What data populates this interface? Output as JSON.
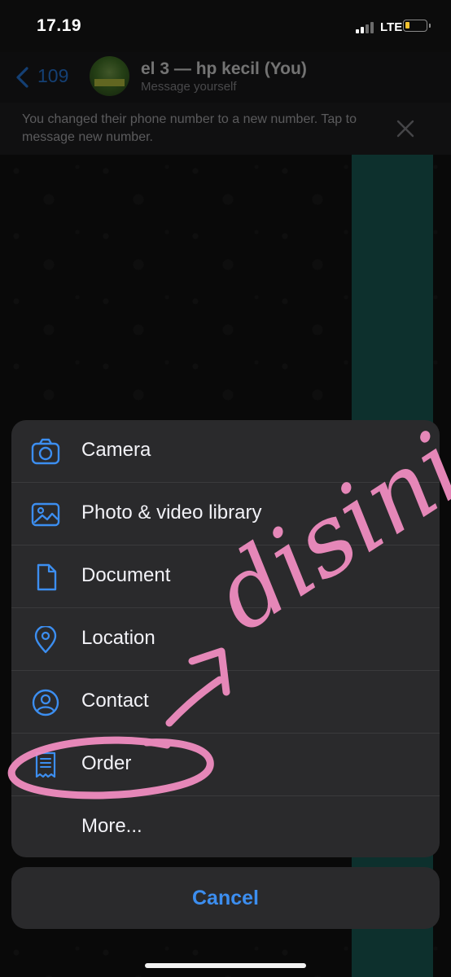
{
  "status_bar": {
    "time": "17.19",
    "network": "LTE",
    "battery_level_percent": 15
  },
  "chat_header": {
    "back_count": "109",
    "title": "el 3 — hp kecil (You)",
    "subtitle": "Message yourself"
  },
  "notice": {
    "text": "You changed their phone number to a new number. Tap to message new number."
  },
  "action_sheet": {
    "items": [
      {
        "label": "Camera",
        "icon": "camera-icon"
      },
      {
        "label": "Photo & video library",
        "icon": "photo-icon"
      },
      {
        "label": "Document",
        "icon": "document-icon"
      },
      {
        "label": "Location",
        "icon": "location-pin-icon"
      },
      {
        "label": "Contact",
        "icon": "contact-icon"
      },
      {
        "label": "Order",
        "icon": "receipt-icon"
      },
      {
        "label": "More...",
        "icon": ""
      }
    ],
    "cancel_label": "Cancel"
  },
  "annotation": {
    "text": "disini",
    "color": "#f08cc0"
  },
  "colors": {
    "accent": "#3c8ef0",
    "sheet_background": "#2a2a2c",
    "teal_bubble": "#1c6b63"
  }
}
